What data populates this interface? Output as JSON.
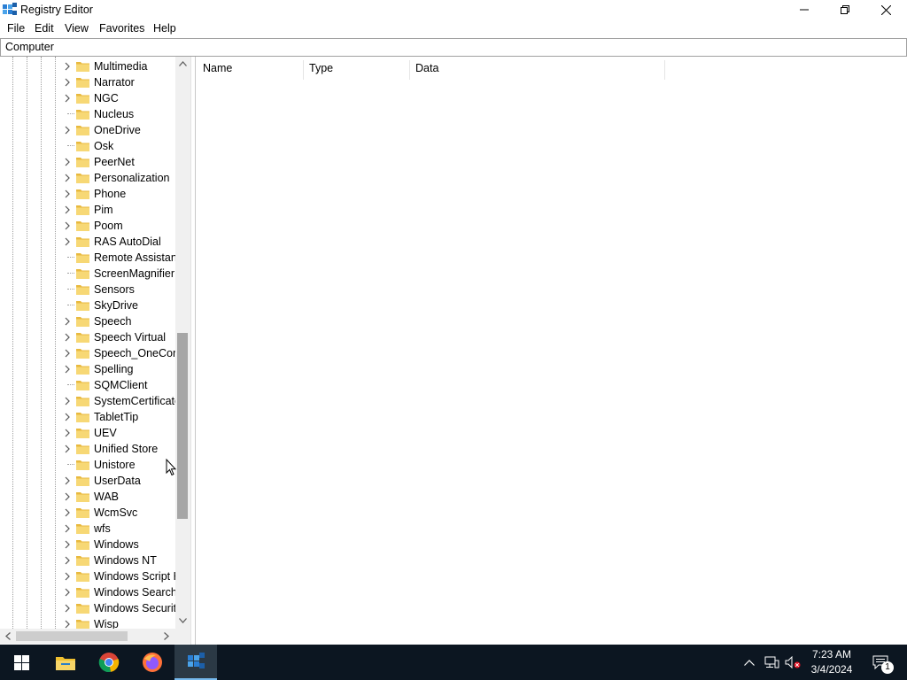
{
  "window": {
    "title": "Registry Editor",
    "minimize_icon": "minimize-icon",
    "restore_icon": "restore-icon",
    "close_icon": "close-icon"
  },
  "menu": [
    "File",
    "Edit",
    "View",
    "Favorites",
    "Help"
  ],
  "address": "Computer",
  "tree": {
    "items": [
      {
        "label": "Multimedia",
        "expandable": true
      },
      {
        "label": "Narrator",
        "expandable": true
      },
      {
        "label": "NGC",
        "expandable": true
      },
      {
        "label": "Nucleus",
        "expandable": false
      },
      {
        "label": "OneDrive",
        "expandable": true
      },
      {
        "label": "Osk",
        "expandable": false
      },
      {
        "label": "PeerNet",
        "expandable": true
      },
      {
        "label": "Personalization",
        "expandable": true
      },
      {
        "label": "Phone",
        "expandable": true
      },
      {
        "label": "Pim",
        "expandable": true
      },
      {
        "label": "Poom",
        "expandable": true
      },
      {
        "label": "RAS AutoDial",
        "expandable": true
      },
      {
        "label": "Remote Assistance",
        "expandable": false
      },
      {
        "label": "ScreenMagnifier",
        "expandable": false
      },
      {
        "label": "Sensors",
        "expandable": false
      },
      {
        "label": "SkyDrive",
        "expandable": false
      },
      {
        "label": "Speech",
        "expandable": true
      },
      {
        "label": "Speech Virtual",
        "expandable": true
      },
      {
        "label": "Speech_OneCore",
        "expandable": true
      },
      {
        "label": "Spelling",
        "expandable": true
      },
      {
        "label": "SQMClient",
        "expandable": false
      },
      {
        "label": "SystemCertificates",
        "expandable": true
      },
      {
        "label": "TabletTip",
        "expandable": true
      },
      {
        "label": "UEV",
        "expandable": true
      },
      {
        "label": "Unified Store",
        "expandable": true
      },
      {
        "label": "Unistore",
        "expandable": false
      },
      {
        "label": "UserData",
        "expandable": true
      },
      {
        "label": "WAB",
        "expandable": true
      },
      {
        "label": "WcmSvc",
        "expandable": true
      },
      {
        "label": "wfs",
        "expandable": true
      },
      {
        "label": "Windows",
        "expandable": true
      },
      {
        "label": "Windows NT",
        "expandable": true
      },
      {
        "label": "Windows Script Host",
        "expandable": true
      },
      {
        "label": "Windows Search",
        "expandable": true
      },
      {
        "label": "Windows Security",
        "expandable": true
      },
      {
        "label": "Wisp",
        "expandable": true
      }
    ]
  },
  "list": {
    "columns": [
      "Name",
      "Type",
      "Data"
    ]
  },
  "taskbar": {
    "start_icon": "windows-start-icon",
    "apps": [
      "file-explorer-icon",
      "chrome-icon",
      "firefox-icon",
      "registry-editor-icon"
    ],
    "clock_time": "7:23 AM",
    "clock_date": "3/4/2024",
    "notification_count": "1"
  },
  "colors": {
    "taskbar_bg": "#0c1621",
    "folder_yellow": "#f4d36b",
    "active_accent": "#76b9ed"
  }
}
